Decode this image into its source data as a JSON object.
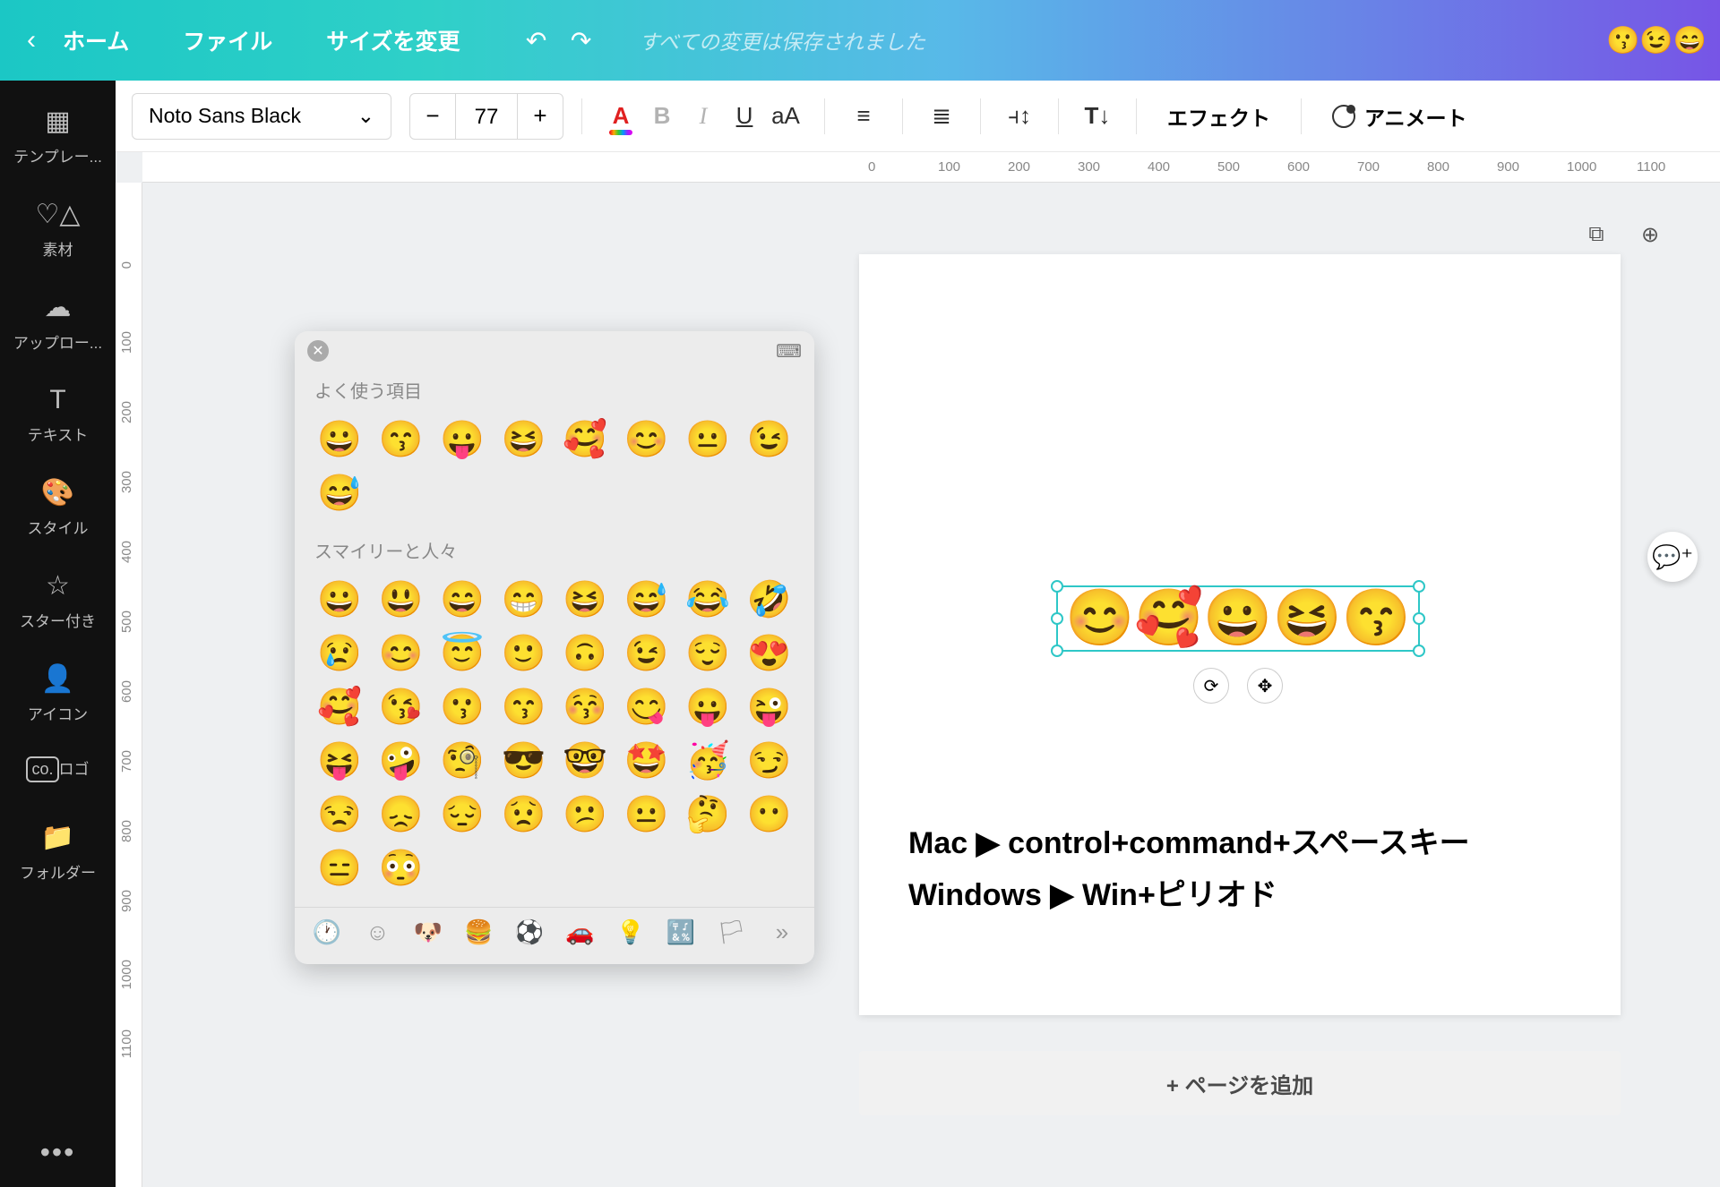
{
  "topbar": {
    "home": "ホーム",
    "file": "ファイル",
    "resize": "サイズを変更",
    "status": "すべての変更は保存されました",
    "right_emojis": "😗😉😄"
  },
  "toolbar": {
    "font_name": "Noto Sans Black",
    "minus": "−",
    "plus": "+",
    "font_size": "77",
    "color_A": "A",
    "bold": "B",
    "italic": "I",
    "underline": "U",
    "case": "aA",
    "effects": "エフェクト",
    "animate": "アニメート"
  },
  "sidebar": {
    "items": [
      {
        "label": "テンプレー...",
        "icon": "▦"
      },
      {
        "label": "素材",
        "icon": "♡△"
      },
      {
        "label": "アップロー...",
        "icon": "☁"
      },
      {
        "label": "テキスト",
        "icon": "T"
      },
      {
        "label": "スタイル",
        "icon": "🎨"
      },
      {
        "label": "スター付き",
        "icon": "☆"
      },
      {
        "label": "アイコン",
        "icon": "👤"
      },
      {
        "label": "ロゴ",
        "icon": "co."
      },
      {
        "label": "フォルダー",
        "icon": "📁"
      }
    ],
    "more": "•••"
  },
  "ruler": {
    "h": [
      "0",
      "100",
      "200",
      "300",
      "400",
      "500",
      "600",
      "700",
      "800",
      "900",
      "1000",
      "1100"
    ],
    "v": [
      "0",
      "100",
      "200",
      "300",
      "400",
      "500",
      "600",
      "700",
      "800",
      "900",
      "1000",
      "1100"
    ]
  },
  "canvas": {
    "selected_emojis": "😊🥰😀😆😙",
    "body_line1": "Mac ▶ control+command+スペースキー",
    "body_line2": "Windows ▶ Win+ピリオド",
    "add_page": "+ ページを追加"
  },
  "emoji_panel": {
    "section_frequent": "よく使う項目",
    "section_smileys": "スマイリーと人々",
    "frequent": [
      "😀",
      "😙",
      "😛",
      "😆",
      "🥰",
      "😊",
      "😐",
      "😉",
      "😅"
    ],
    "smileys": [
      "😀",
      "😃",
      "😄",
      "😁",
      "😆",
      "😅",
      "😂",
      "🤣",
      "😢",
      "😊",
      "😇",
      "🙂",
      "🙃",
      "😉",
      "😌",
      "😍",
      "🥰",
      "😘",
      "😗",
      "😙",
      "😚",
      "😋",
      "😛",
      "😜",
      "😝",
      "🤪",
      "🧐",
      "😎",
      "🤓",
      "🤩",
      "🥳",
      "😏",
      "😒",
      "😞",
      "😔",
      "😟",
      "😕",
      "😐",
      "🤔",
      "😶",
      "😑",
      "😳"
    ],
    "categories": [
      "🕐",
      "☺",
      "🐶",
      "🍔",
      "⚽",
      "🚗",
      "💡",
      "🔣",
      "🏳",
      "»"
    ]
  }
}
